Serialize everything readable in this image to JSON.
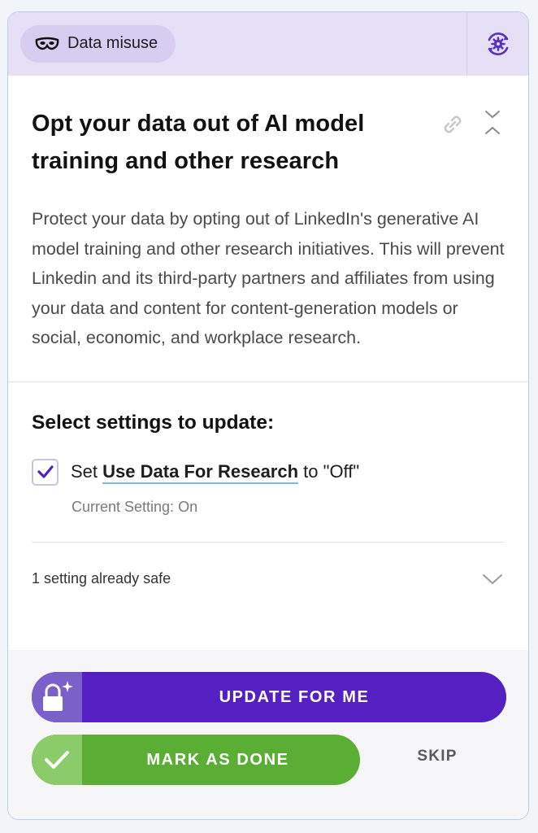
{
  "header": {
    "badge_label": "Data misuse",
    "badge_icon": "mask-icon",
    "settings_icon": "gear-icon",
    "colors": {
      "header_bg": "#e6e0f7",
      "badge_bg": "#d6cdf1",
      "accent": "#5420c1"
    }
  },
  "task": {
    "title": "Opt your data out of AI model training and other research",
    "description": "Protect your data by opting out of LinkedIn's generative AI model training and other research initiatives. This will prevent Linkedin and its third-party partners and affiliates from using your data and content for content-generation models or social, economic, and workplace research."
  },
  "settings": {
    "heading": "Select settings to update:",
    "items": [
      {
        "checked": true,
        "prefix": "Set",
        "setting_name": "Use Data For Research",
        "suffix": "to \"Off\"",
        "current": "Current Setting: On"
      }
    ],
    "safe_summary": "1 setting already safe"
  },
  "actions": {
    "update_label": "UPDATE FOR ME",
    "done_label": "MARK AS DONE",
    "skip_label": "SKIP",
    "colors": {
      "update": "#5420c1",
      "done": "#5aae34"
    }
  }
}
